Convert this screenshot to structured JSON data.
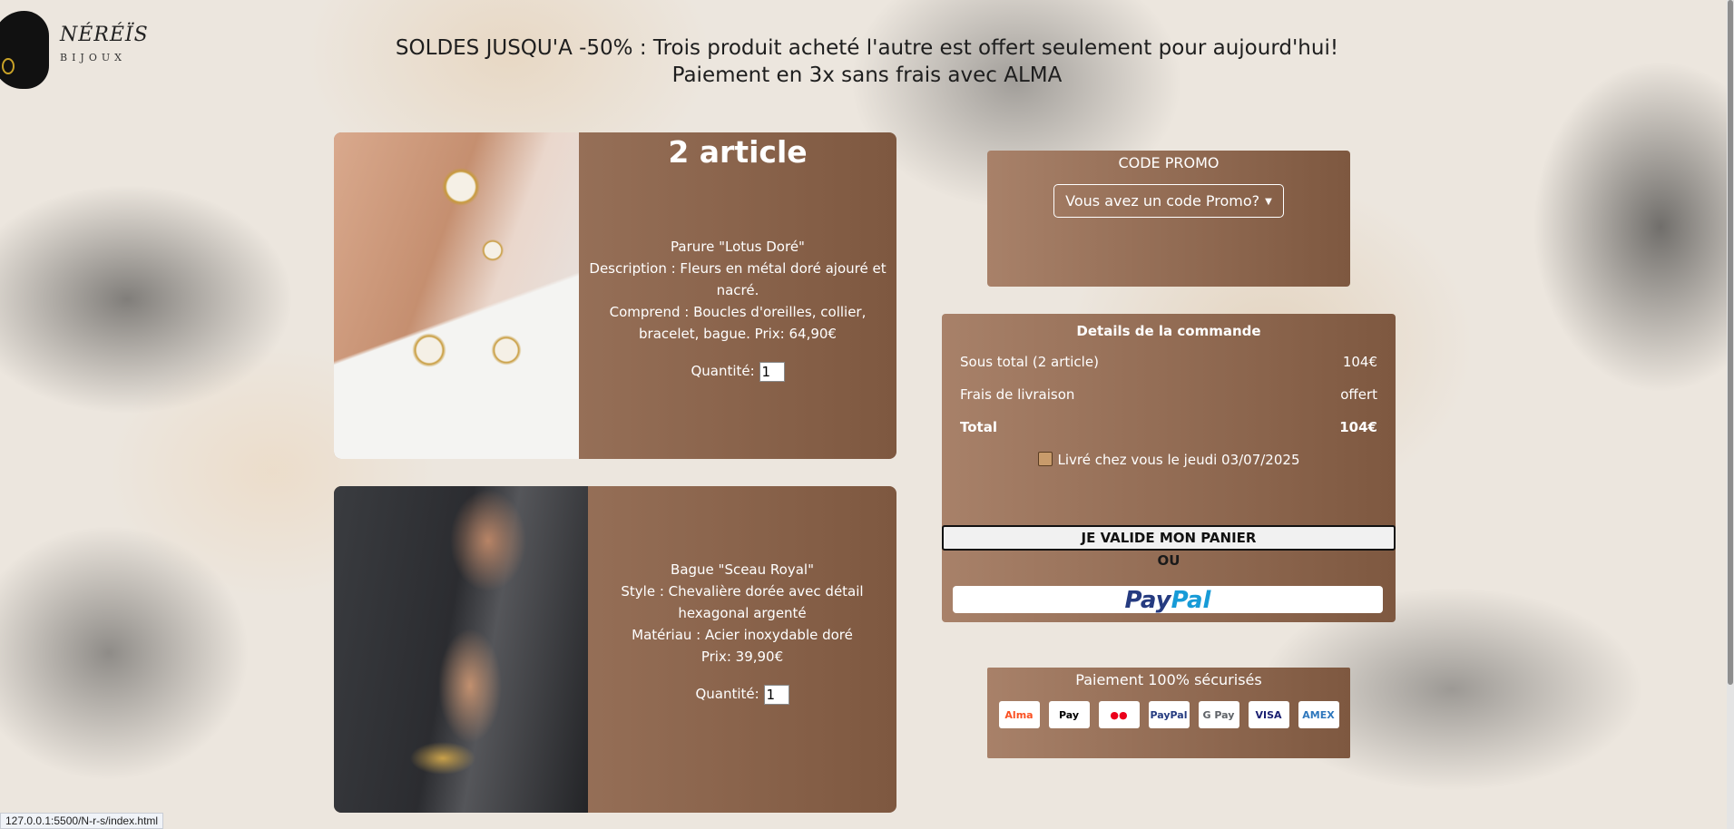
{
  "logo": {
    "name": "NÉRÉÏS",
    "sub": "BIJOUX"
  },
  "banner": {
    "line1": "SOLDES JUSQU'A -50% : Trois produit acheté l'autre est offert seulement pour aujourd'hui!",
    "line2": "Paiement en 3x sans frais avec ALMA"
  },
  "cart": {
    "count_title": "2 article",
    "items": [
      {
        "name": "Parure \"Lotus Doré\"",
        "line2": "Description : Fleurs en métal doré ajouré et nacré.",
        "line3": "Comprend : Boucles d'oreilles, collier, bracelet, bague. Prix: 64,90€",
        "quantity_label": "Quantité:",
        "quantity": "1"
      },
      {
        "name": "Bague \"Sceau Royal\"",
        "line2": "Style : Chevalière dorée avec détail hexagonal argenté",
        "line3": "Matériau : Acier inoxydable doré",
        "line4": "Prix: 39,90€",
        "quantity_label": "Quantité:",
        "quantity": "1"
      }
    ]
  },
  "promo": {
    "label": "CODE PROMO",
    "dropdown": "Vous avez un code Promo?"
  },
  "summary": {
    "title": "Details de la commande",
    "rows": [
      {
        "label": "Sous total (2 article)",
        "value": "104€"
      },
      {
        "label": "Frais de livraison",
        "value": "offert"
      },
      {
        "label": "Total",
        "value": "104€"
      }
    ],
    "delivery": "Livré chez vous le jeudi 03/07/2025",
    "validate_button": "JE VALIDE MON PANIER",
    "or": "OU",
    "paypal_a": "Pay",
    "paypal_b": "Pal"
  },
  "secure": {
    "label": "Paiement 100% sécurisés",
    "cards": [
      {
        "text": "Alma",
        "color": "#fa5022"
      },
      {
        "text": "Pay",
        "color": "#000000"
      },
      {
        "text": "●●",
        "color": "#eb001b"
      },
      {
        "text": "PayPal",
        "color": "#253b80"
      },
      {
        "text": "G Pay",
        "color": "#5f6368"
      },
      {
        "text": "VISA",
        "color": "#1a1f71"
      },
      {
        "text": "AMEX",
        "color": "#2e77bc"
      }
    ]
  },
  "status_url": "127.0.0.1:5500/N-r-s/index.html"
}
